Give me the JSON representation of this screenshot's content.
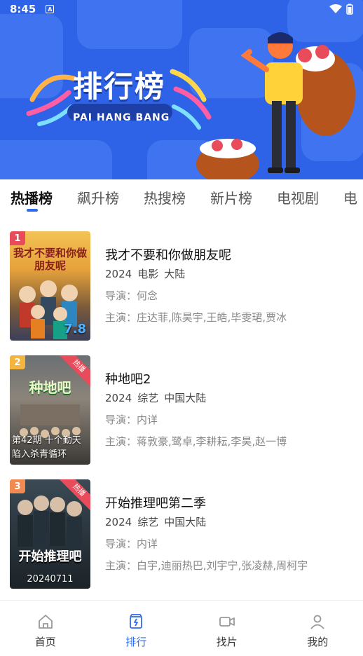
{
  "status_bar": {
    "time": "8:45",
    "notification_icon": "A"
  },
  "banner": {
    "title": "排行榜",
    "subtitle": "PAI HANG BANG",
    "logo_badge": "我才不要和你做朋友呢"
  },
  "tabs": [
    {
      "label": "热播榜",
      "active": true
    },
    {
      "label": "飙升榜"
    },
    {
      "label": "热搜榜"
    },
    {
      "label": "新片榜"
    },
    {
      "label": "电视剧"
    },
    {
      "label": "电"
    }
  ],
  "items": [
    {
      "rank": "1",
      "rank_color": "#e84b5a",
      "title": "我才不要和你做朋友呢",
      "year": "2024",
      "type": "电影",
      "region": "大陆",
      "director_label": "导演：",
      "director": "何念",
      "cast_label": "主演：",
      "cast": "庄达菲,陈昊宇,王皓,毕雯珺,贾冰",
      "poster_text": "我才不要和你做朋友呢",
      "poster_date": "7.8",
      "hot": false
    },
    {
      "rank": "2",
      "rank_color": "#f4b53f",
      "title": "种地吧2",
      "year": "2024",
      "type": "综艺",
      "region": "中国大陆",
      "director_label": "导演：",
      "director": "内详",
      "cast_label": "主演：",
      "cast": "蒋敦豪,鹭卓,李耕耘,李昊,赵一博",
      "poster_text": "种地吧",
      "poster_caption": "第42期 十个勤天陷入杀青循环",
      "hot": true,
      "hot_label": "热播"
    },
    {
      "rank": "3",
      "rank_color": "#f08a50",
      "title": "开始推理吧第二季",
      "year": "2024",
      "type": "综艺",
      "region": "中国大陆",
      "director_label": "导演：",
      "director": "内详",
      "cast_label": "主演：",
      "cast": "白宇,迪丽热巴,刘宇宁,张凌赫,周柯宇",
      "poster_text": "开始推理吧",
      "poster_date": "20240711",
      "hot": true,
      "hot_label": "热播"
    }
  ],
  "bottom_nav": [
    {
      "label": "首页",
      "icon": "home-icon"
    },
    {
      "label": "排行",
      "icon": "ranking-icon",
      "active": true
    },
    {
      "label": "找片",
      "icon": "video-camera-icon"
    },
    {
      "label": "我的",
      "icon": "user-icon"
    }
  ],
  "colors": {
    "accent": "#2f6bf2",
    "banner": "#2e63e8",
    "hot": "#e84b5a"
  }
}
